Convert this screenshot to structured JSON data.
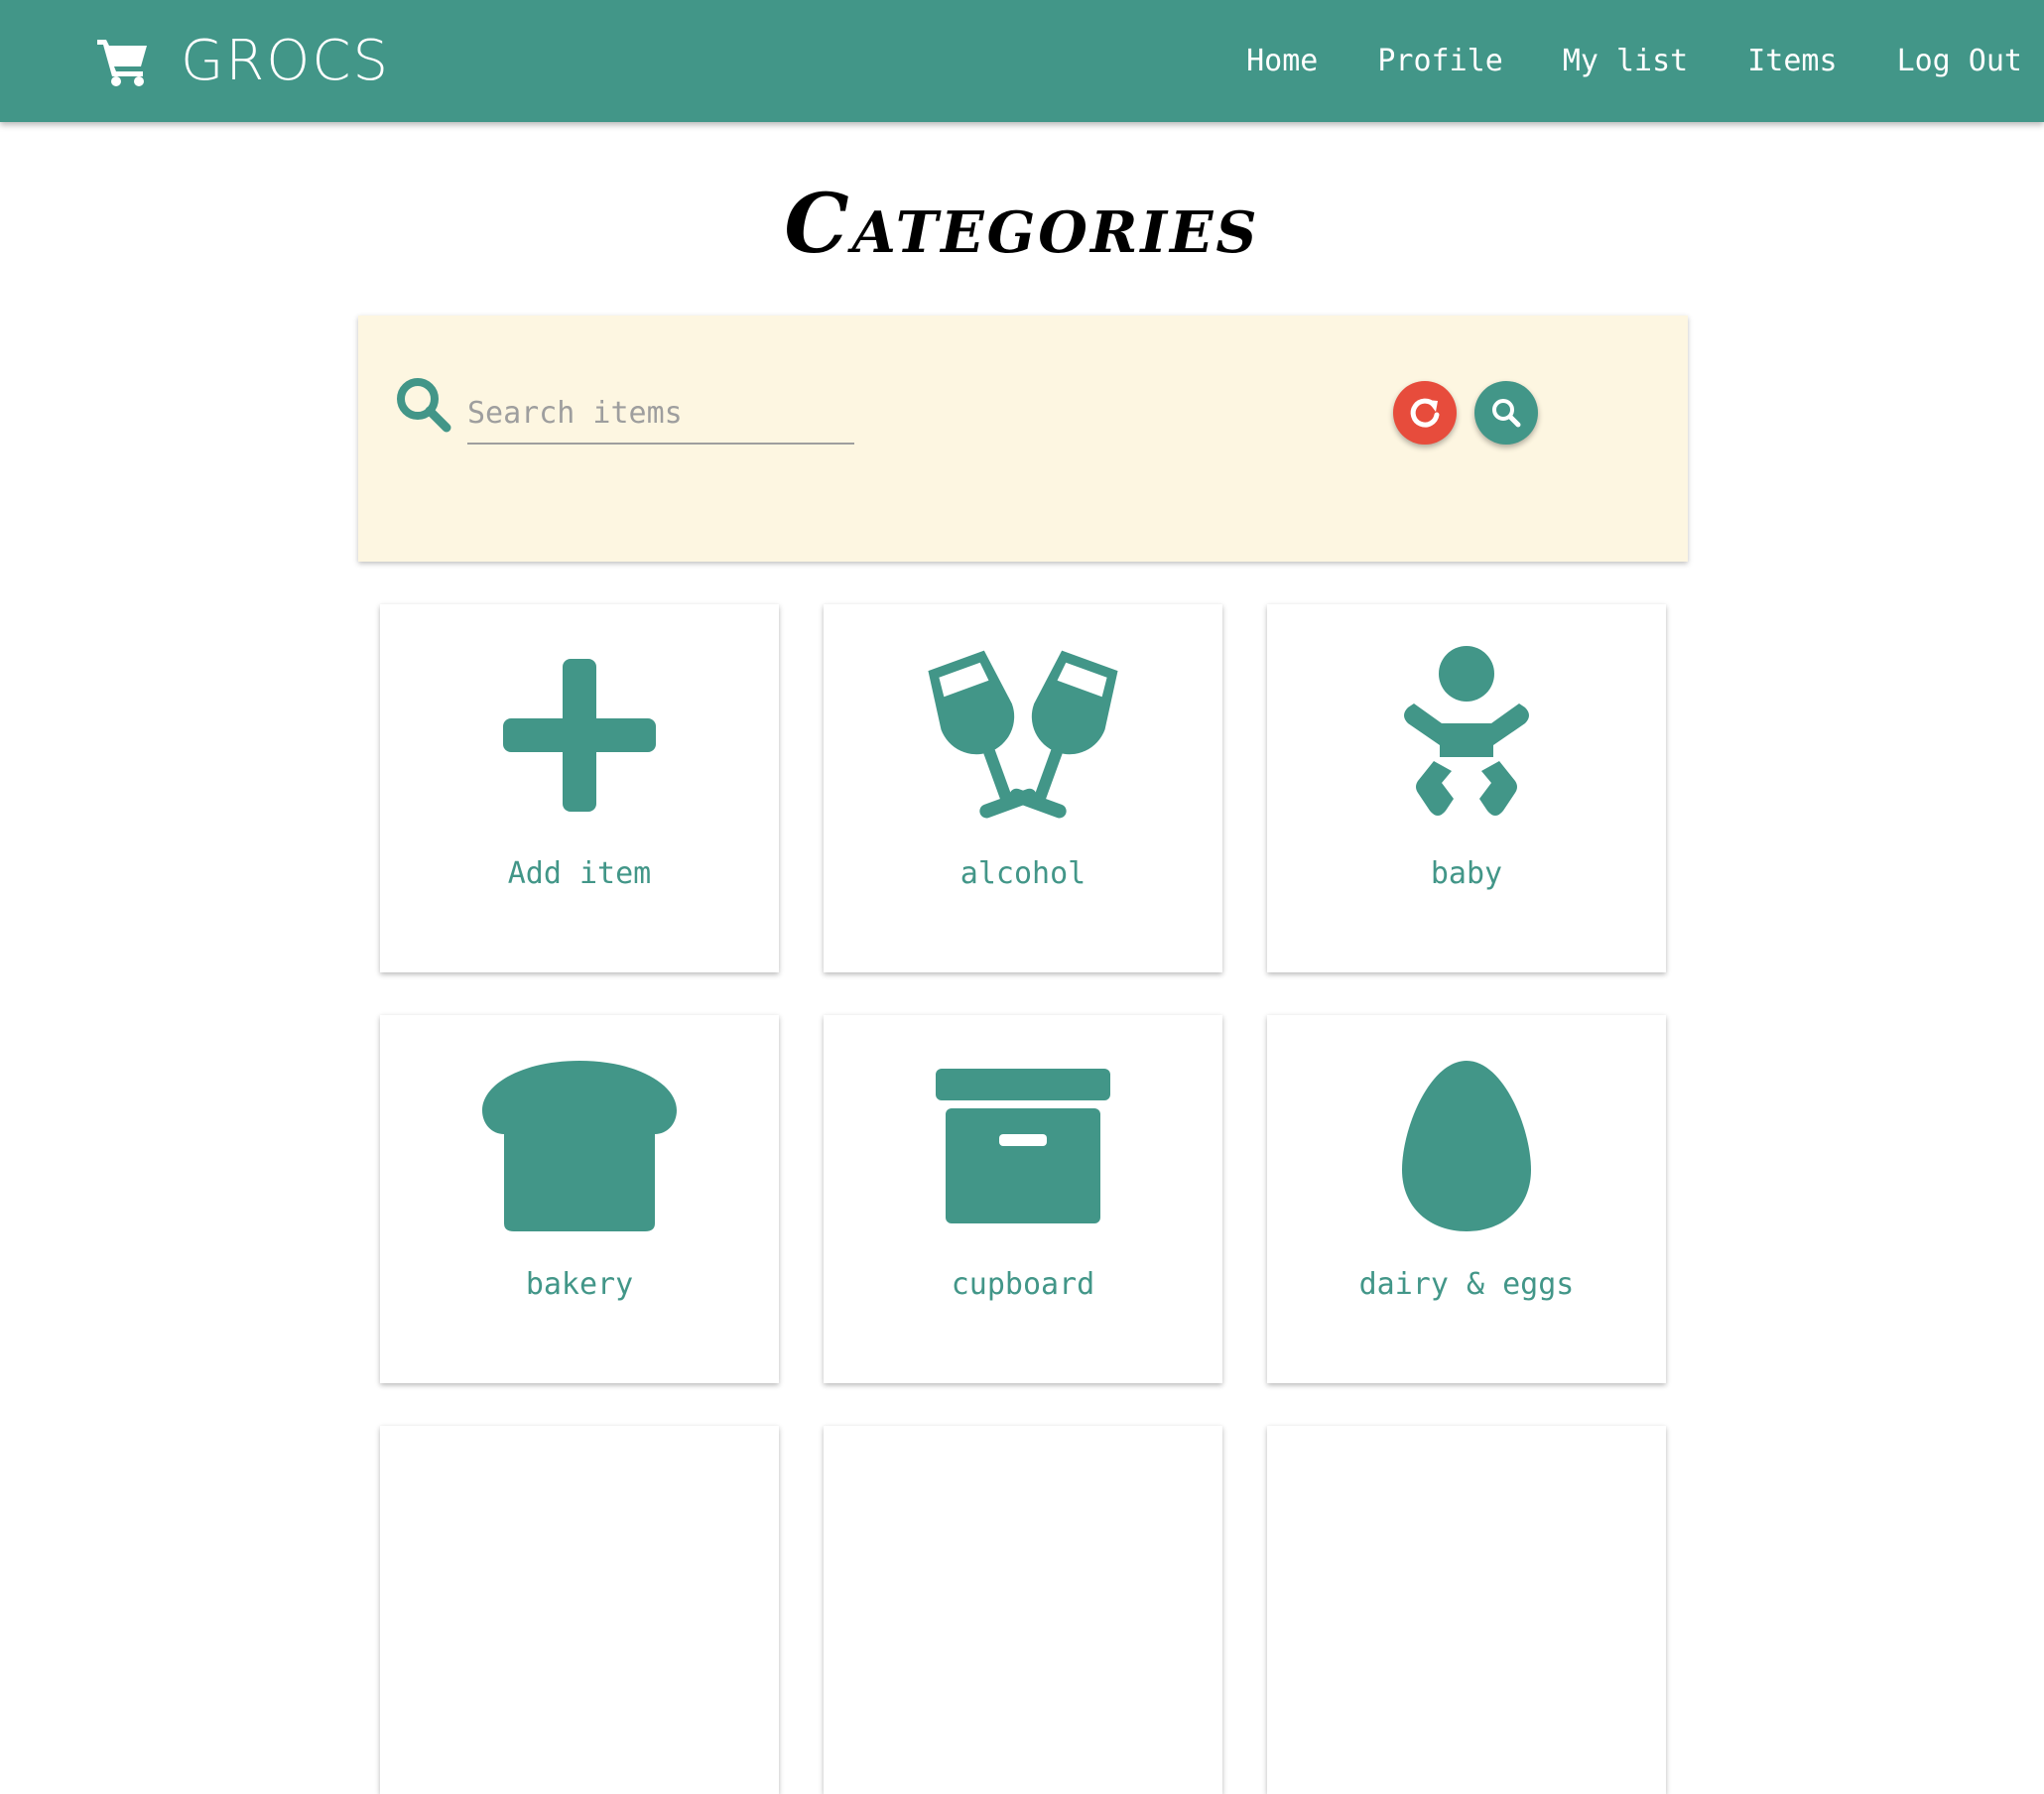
{
  "navbar": {
    "brand": "GROCS",
    "brand_icon": "shopping-cart-icon",
    "links": [
      "Home",
      "Profile",
      "My list",
      "Items",
      "Log Out"
    ]
  },
  "page": {
    "title": "Categories"
  },
  "search": {
    "placeholder": "Search items",
    "value": "",
    "icon": "magnifier-icon",
    "reset_button_icon": "refresh-icon",
    "search_button_icon": "search-icon"
  },
  "categories": [
    {
      "label": "Add item",
      "icon": "plus-icon"
    },
    {
      "label": "alcohol",
      "icon": "wine-glasses-icon"
    },
    {
      "label": "baby",
      "icon": "baby-icon"
    },
    {
      "label": "bakery",
      "icon": "bread-icon"
    },
    {
      "label": "cupboard",
      "icon": "box-icon"
    },
    {
      "label": "dairy & eggs",
      "icon": "egg-icon"
    }
  ],
  "colors": {
    "primary": "#429688",
    "panel": "#fdf6e1",
    "reset": "#e74c3c"
  }
}
